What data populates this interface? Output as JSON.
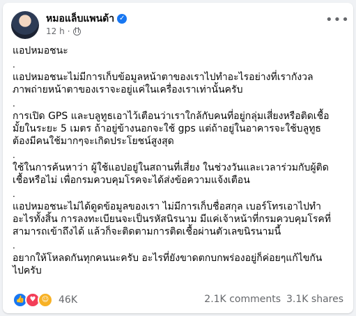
{
  "post": {
    "author": "หมอแล็บแพนด้า",
    "time": "12 h",
    "dot_sep": "·",
    "title": "แอปหมอชนะ",
    "paragraphs": [
      "แอปหมอชนะไม่มีการเก็บข้อมูลหน้าตาของเราไปทำอะไรอย่างที่เรากังวล\nภาพถ่ายหน้าตาของเราจะอยู่แค่ในเครื่องเราเท่านั้นครับ",
      "การเปิด GPS และบลูทูธเอาไว้เตือนว่าเราใกล้กับคนที่อยู่กลุ่มเสี่ยงหรือติดเชื้อ\nมั้ยในระยะ 5 เมตร ถ้าอยู่ข้างนอกจะใช้ gps แต่ถ้าอยู่ในอาคารจะใช้บลูทูธ\nต้องมีคนใช้มากๆจะเกิดประโยชน์สูงสุด",
      "ใช้ในการค้นหาว่า ผู้ใช้แอปอยู่ในสถานที่เสี่ยง ในช่วงวันและเวลาร่วมกับผู้ติด\nเชื้อหรือไม่ เพื่อกรมควบคุมโรคจะได้ส่งข้อความแจ้งเตือน",
      "แอปหมอชนะไม่ได้ดูดข้อมูลของเรา ไม่มีการเก็บชื่อสกุล เบอร์โทรเอาไปทำ\nอะไรทั้งสิ้น การลงทะเบียนจะเป็นรหัสนิรนาม มีแค่เจ้าหน้าที่กรมควบคุมโรคที่\nสามารถเข้าถึงได้ แล้วก็จะติดตามการติดเชื้อผ่านตัวเลขนิรนามนี้",
      "อยากให้โหลดกันทุกคนนะครับ อะไรที่ยังขาดตกบกพร่องอยู่ก็ค่อยๆแก้ไขกัน\nไปครับ"
    ],
    "separator": "."
  },
  "reactions": {
    "count": "46K",
    "icons": [
      "like-icon",
      "love-icon",
      "haha-icon"
    ]
  },
  "stats": {
    "comments": "2.1K comments",
    "shares": "3.1K shares"
  },
  "colors": {
    "verified": "#1877f2",
    "like": "#1877f2",
    "love": "#f33e58",
    "haha": "#f7b125"
  }
}
